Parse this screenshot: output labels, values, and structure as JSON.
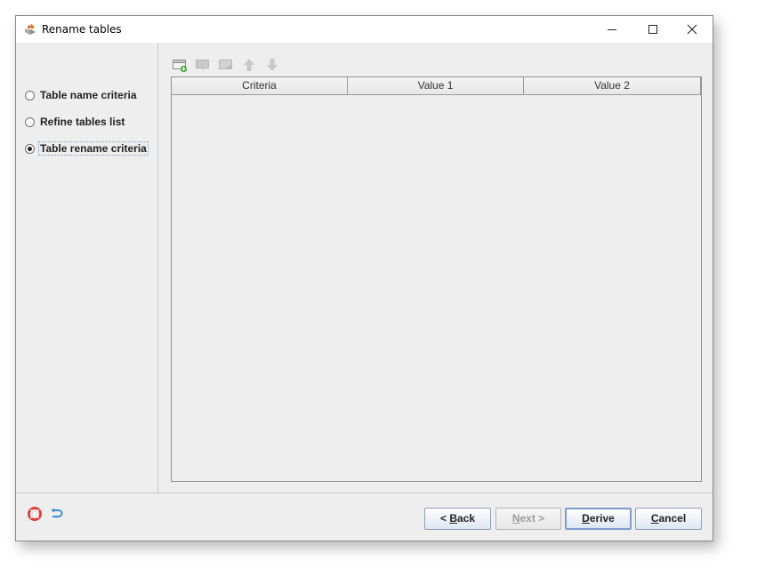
{
  "window": {
    "title": "Rename tables",
    "controls": [
      "minimize-icon",
      "maximize-icon",
      "close-icon"
    ]
  },
  "steps": [
    {
      "label": "Table name criteria",
      "selected": false
    },
    {
      "label": "Refine tables list",
      "selected": false
    },
    {
      "label": "Table rename criteria",
      "selected": true
    }
  ],
  "toolbar": {
    "icons": [
      "add-row-icon",
      "edit-row-icon",
      "delete-row-icon",
      "move-up-icon",
      "move-down-icon"
    ]
  },
  "grid": {
    "columns": [
      "Criteria",
      "Value 1",
      "Value 2"
    ],
    "rows": []
  },
  "footer": {
    "icons": [
      "help-icon",
      "reset-icon"
    ],
    "buttons": {
      "back": {
        "prefix": "< ",
        "mnemonic": "B",
        "rest": "ack"
      },
      "next": {
        "mnemonic": "N",
        "rest": "ext >"
      },
      "derive": {
        "mnemonic": "D",
        "rest": "erive"
      },
      "cancel": {
        "mnemonic": "C",
        "rest": "ancel"
      }
    }
  },
  "colors": {
    "window_bg": "#eeeeee",
    "button_border": "#8f9fb6",
    "default_button_border": "#7f9ad0",
    "help_icon": "#d9413a",
    "reset_icon": "#3a8fd9"
  }
}
